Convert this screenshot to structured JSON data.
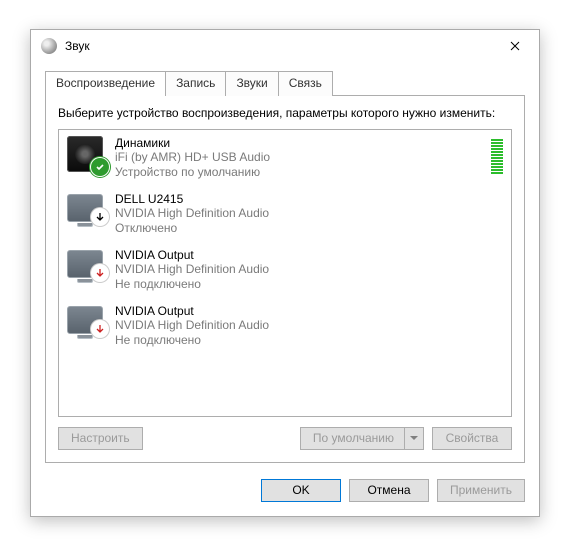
{
  "window": {
    "title": "Звук",
    "close_label": "Закрыть"
  },
  "tabs": [
    {
      "label": "Воспроизведение",
      "active": true
    },
    {
      "label": "Запись",
      "active": false
    },
    {
      "label": "Звуки",
      "active": false
    },
    {
      "label": "Связь",
      "active": false
    }
  ],
  "instruction": "Выберите устройство воспроизведения, параметры которого нужно изменить:",
  "devices": [
    {
      "name": "Динамики",
      "desc": "iFi (by AMR) HD+ USB Audio",
      "status": "Устройство по умолчанию",
      "icon": "speaker",
      "badge": "check-green",
      "meter": true
    },
    {
      "name": "DELL U2415",
      "desc": "NVIDIA High Definition Audio",
      "status": "Отключено",
      "icon": "monitor",
      "badge": "arrow-black",
      "meter": false
    },
    {
      "name": "NVIDIA Output",
      "desc": "NVIDIA High Definition Audio",
      "status": "Не подключено",
      "icon": "monitor",
      "badge": "arrow-red",
      "meter": false
    },
    {
      "name": "NVIDIA Output",
      "desc": "NVIDIA High Definition Audio",
      "status": "Не подключено",
      "icon": "monitor",
      "badge": "arrow-red",
      "meter": false
    }
  ],
  "panel_buttons": {
    "configure": "Настроить",
    "set_default": "По умолчанию",
    "properties": "Свойства"
  },
  "dialog_buttons": {
    "ok": "OK",
    "cancel": "Отмена",
    "apply": "Применить"
  },
  "colors": {
    "accent": "#0078d7",
    "meter": "#2bbd2b",
    "badge_ok": "#2e9b2e",
    "badge_err": "#cc1f1f"
  }
}
